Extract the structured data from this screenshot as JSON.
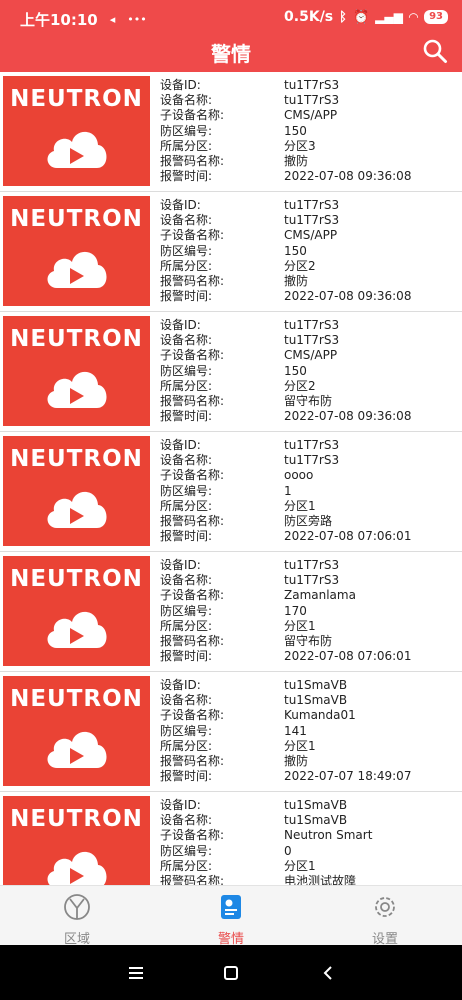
{
  "status_bar": {
    "time": "上午10:10",
    "net_speed": "0.5K/s",
    "battery": "93"
  },
  "header": {
    "title": "警情"
  },
  "labels": {
    "device_id": "设备ID:",
    "device_name": "设备名称:",
    "sub_device_name": "子设备名称:",
    "zone_no": "防区编号:",
    "partition": "所属分区:",
    "alarm_code": "报警码名称:",
    "alarm_time": "报警时间:"
  },
  "brand": "NEUTRON",
  "alarms": [
    {
      "device_id": "tu1T7rS3",
      "device_name": "tu1T7rS3",
      "sub_device_name": "CMS/APP",
      "zone_no": "150",
      "partition": "分区3",
      "alarm_code": "撤防",
      "alarm_time": "2022-07-08 09:36:08"
    },
    {
      "device_id": "tu1T7rS3",
      "device_name": "tu1T7rS3",
      "sub_device_name": "CMS/APP",
      "zone_no": "150",
      "partition": "分区2",
      "alarm_code": "撤防",
      "alarm_time": "2022-07-08 09:36:08"
    },
    {
      "device_id": "tu1T7rS3",
      "device_name": "tu1T7rS3",
      "sub_device_name": "CMS/APP",
      "zone_no": "150",
      "partition": "分区2",
      "alarm_code": "留守布防",
      "alarm_time": "2022-07-08 09:36:08"
    },
    {
      "device_id": "tu1T7rS3",
      "device_name": "tu1T7rS3",
      "sub_device_name": "oooo",
      "zone_no": "1",
      "partition": "分区1",
      "alarm_code": "防区旁路",
      "alarm_time": "2022-07-08 07:06:01"
    },
    {
      "device_id": "tu1T7rS3",
      "device_name": "tu1T7rS3",
      "sub_device_name": "Zamanlama",
      "zone_no": "170",
      "partition": "分区1",
      "alarm_code": "留守布防",
      "alarm_time": "2022-07-08 07:06:01"
    },
    {
      "device_id": "tu1SmaVB",
      "device_name": "tu1SmaVB",
      "sub_device_name": "Kumanda01",
      "zone_no": "141",
      "partition": "分区1",
      "alarm_code": "撤防",
      "alarm_time": "2022-07-07 18:49:07"
    },
    {
      "device_id": "tu1SmaVB",
      "device_name": "tu1SmaVB",
      "sub_device_name": "Neutron Smart",
      "zone_no": "0",
      "partition": "分区1",
      "alarm_code": "电池测试故障",
      "alarm_time": ""
    }
  ],
  "tabs": [
    {
      "label": "区域",
      "active": false
    },
    {
      "label": "警情",
      "active": true
    },
    {
      "label": "设置",
      "active": false
    }
  ],
  "colors": {
    "brand_red": "#ef4a4a",
    "thumb_red": "#ea4335"
  }
}
